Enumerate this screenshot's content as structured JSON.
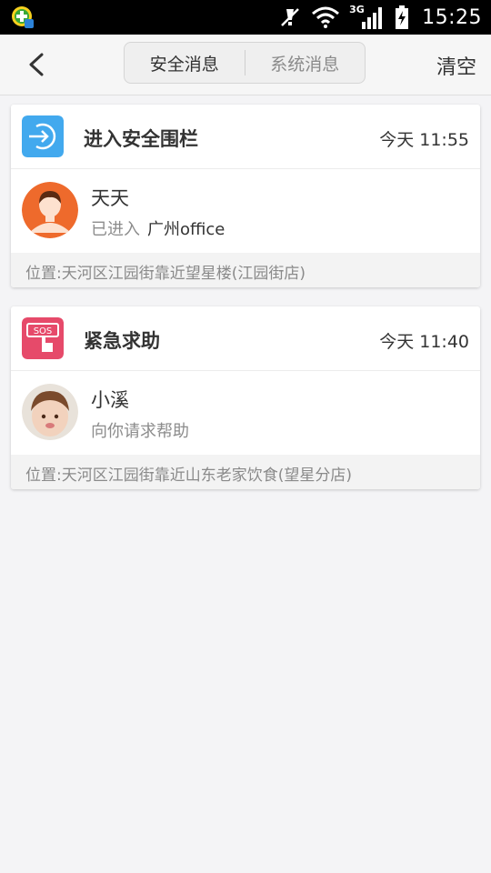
{
  "status_bar": {
    "network_label": "3G",
    "time": "15:25",
    "icons": [
      "app-notification-icon",
      "mute-icon",
      "wifi-icon",
      "signal-icon",
      "battery-charging-icon"
    ]
  },
  "header": {
    "back_icon": "chevron-left-icon",
    "tabs": [
      {
        "label": "安全消息",
        "active": true
      },
      {
        "label": "系统消息",
        "active": false
      }
    ],
    "clear_label": "清空"
  },
  "messages": [
    {
      "icon": "enter-fence-icon",
      "icon_color": "#42a9ee",
      "title": "进入安全围栏",
      "time": "今天 11:55",
      "person": "天天",
      "status_prefix": "已进入",
      "place": "广州office",
      "location": "位置:天河区江园街靠近望星楼(江园街店)"
    },
    {
      "icon": "sos-icon",
      "icon_color": "#e64a6a",
      "title": "紧急求助",
      "time": "今天 11:40",
      "person": "小溪",
      "status_prefix": "向你请求帮助",
      "place": "",
      "location": "位置:天河区江园街靠近山东老家饮食(望星分店)"
    }
  ],
  "colors": {
    "background": "#f4f4f6",
    "header": "#f6f6f6",
    "avatar_orange": "#ee6a2c"
  }
}
